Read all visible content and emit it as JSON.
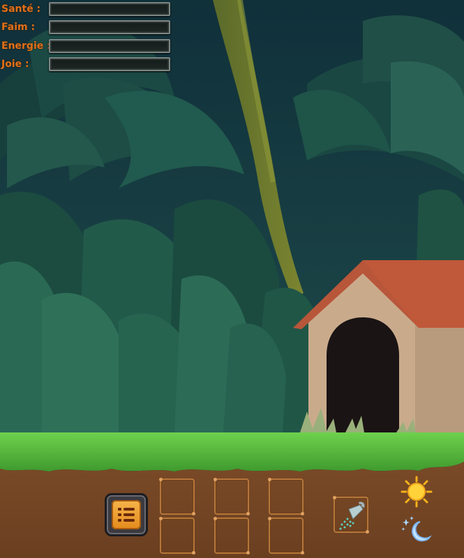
{
  "stats": [
    {
      "label": "Santé :",
      "value": 0
    },
    {
      "label": "Faim :",
      "value": 0
    },
    {
      "label": "Energie :",
      "value": 0
    },
    {
      "label": "Joie :",
      "value": 0
    }
  ],
  "inventory": {
    "slot_count": 6,
    "tool_slot_icon": "shower-icon"
  },
  "menu_icon": "list-icon",
  "time_controls": {
    "day_icon": "sun-icon",
    "night_icon": "moon-icon"
  },
  "colors": {
    "label": "#e0701a",
    "sky": "#12303c",
    "grass": "#5cbf45",
    "soil": "#7b4a26",
    "roof": "#b8563a",
    "kennel_wall": "#c9ab8c"
  }
}
